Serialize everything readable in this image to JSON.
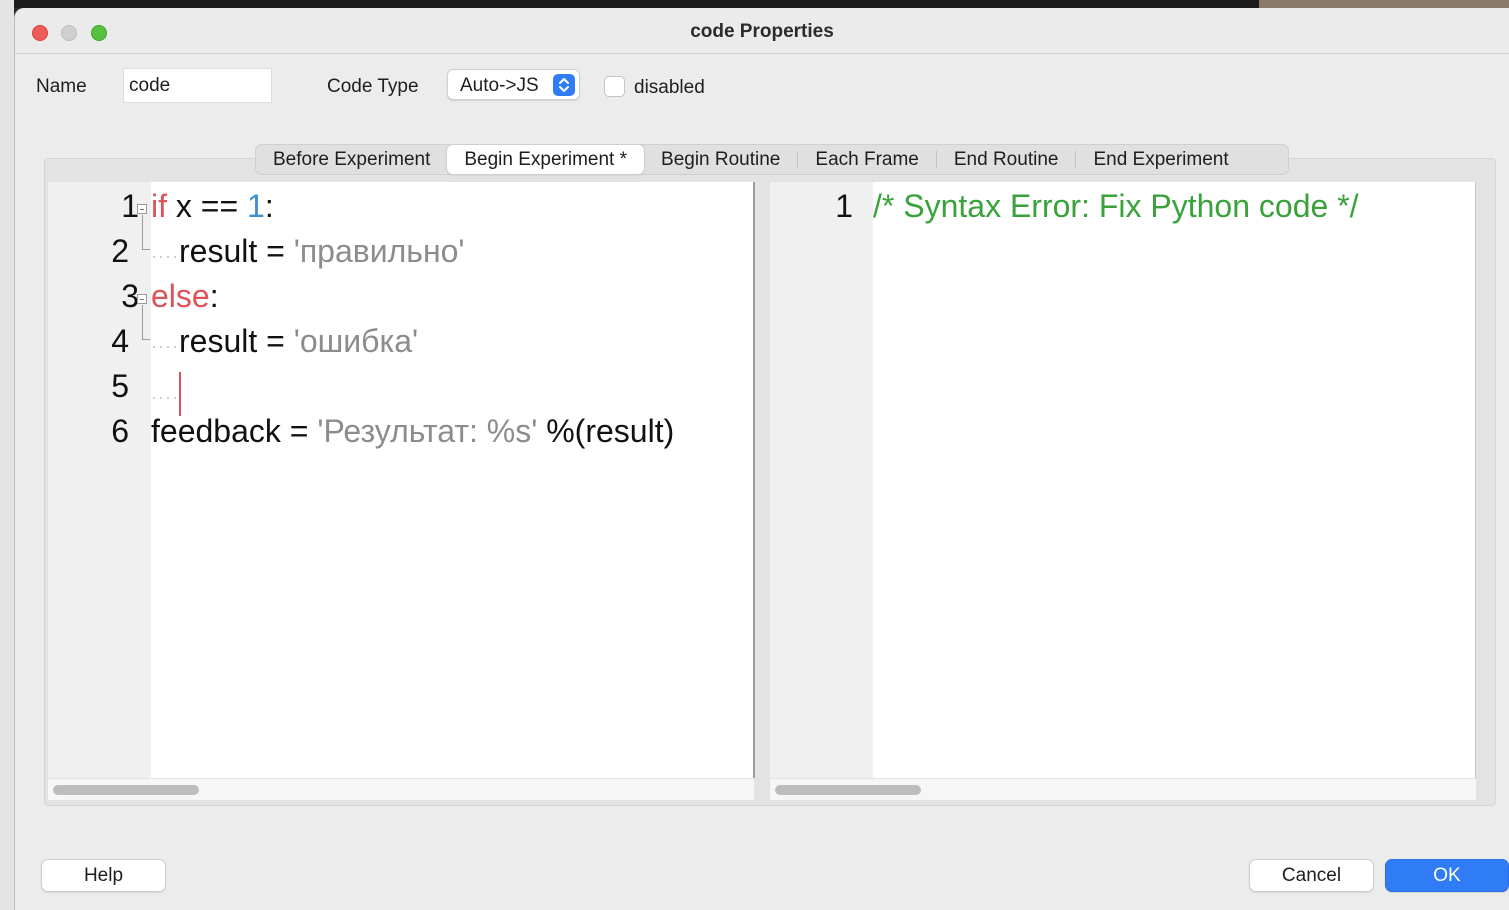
{
  "window": {
    "title": "code Properties"
  },
  "form": {
    "name_label": "Name",
    "name_value": "code",
    "code_type_label": "Code Type",
    "code_type_value": "Auto->JS",
    "disabled_label": "disabled",
    "disabled_checked": false
  },
  "tabs": [
    {
      "label": "Before Experiment",
      "active": false
    },
    {
      "label": "Begin Experiment *",
      "active": true
    },
    {
      "label": "Begin Routine",
      "active": false
    },
    {
      "label": "Each Frame",
      "active": false
    },
    {
      "label": "End Routine",
      "active": false
    },
    {
      "label": "End Experiment",
      "active": false
    }
  ],
  "python_editor": {
    "line_numbers": [
      "1",
      "2",
      "3",
      "4",
      "5",
      "6"
    ],
    "lines": [
      {
        "parts": [
          "if",
          " x == ",
          "1",
          ":"
        ]
      },
      {
        "parts": [
          "result = ",
          "'правильно'"
        ]
      },
      {
        "parts": [
          "else",
          ":"
        ]
      },
      {
        "parts": [
          "result = ",
          "'ошибка'"
        ]
      },
      {
        "parts": []
      },
      {
        "parts": [
          "feedback = ",
          "'Результат: %s'",
          " %(result)"
        ]
      }
    ]
  },
  "js_editor": {
    "line_numbers": [
      "1"
    ],
    "lines": [
      "/* Syntax Error: Fix Python code */"
    ]
  },
  "buttons": {
    "help": "Help",
    "cancel": "Cancel",
    "ok": "OK"
  },
  "colors": {
    "keyword": "#e0525a",
    "number": "#3d8fd4",
    "string": "#8c8c8c",
    "comment": "#3aa23a",
    "ok_button": "#2f7cf6"
  }
}
